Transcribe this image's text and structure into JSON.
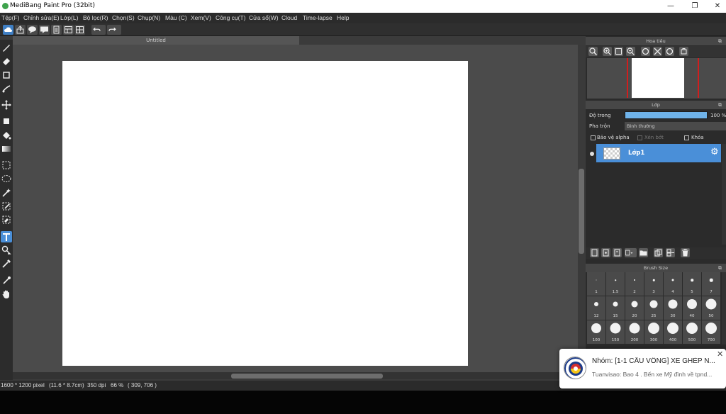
{
  "window": {
    "title": "MediBang Paint Pro (32bit)"
  },
  "menu": [
    "Tệp(F)",
    "Chỉnh sửa(E)",
    "Lớp(L)",
    "Bộ lọc(R)",
    "Chọn(S)",
    "Chụp(N)",
    "Màu (C)",
    "Xem(V)",
    "Công cụ(T)",
    "Cửa sổ(W)",
    "Cloud",
    "Time-lapse",
    "Help"
  ],
  "document": {
    "tab_title": "Untitled"
  },
  "panels": {
    "navigator": {
      "title": "Hoa tiêu"
    },
    "layers": {
      "title": "Lớp",
      "opacity_label": "Độ trong",
      "opacity_value": "100 %",
      "opacity_fraction": 1.0,
      "blend_label": "Pha trộn",
      "blend_value": "Bình thường",
      "protect_alpha_label": "Bảo vệ alpha",
      "clipping_label": "Xén bớt",
      "lock_label": "Khóa",
      "layer_name": "Lớp1"
    },
    "brush_size": {
      "title": "Brush Size",
      "sizes": [
        "1",
        "1.5",
        "2",
        "3",
        "4",
        "5",
        "7",
        "12",
        "15",
        "20",
        "25",
        "30",
        "40",
        "50",
        "100",
        "150",
        "200",
        "300",
        "400",
        "500",
        "700"
      ]
    }
  },
  "status": {
    "dimensions": "1600 * 1200 pixel",
    "physical_size": "(11.6 * 8.7cm)",
    "dpi": "350 dpi",
    "zoom": "66 %",
    "cursor": "( 309, 706 )"
  },
  "notification": {
    "title": "Nhóm: [1-1 CẦU VỒNG] XE GHÉP N...",
    "message": "Tuanvisao: Bao 4 . Bến xe Mỹ đình về tpnd..."
  },
  "colors": {
    "accent": "#4a8fd8",
    "canvas_bg": "#4b4b4b",
    "panel_bg": "#2b2b2b",
    "nav_frame": "#d01e1e"
  }
}
